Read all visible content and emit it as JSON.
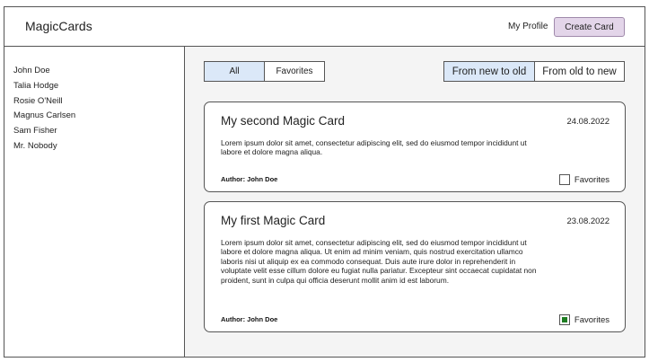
{
  "app": {
    "brand": "MagicCards",
    "nav": {
      "profile_label": "My Profile",
      "create_label": "Create Card"
    }
  },
  "sidebar": {
    "users": [
      "John Doe",
      "Talia Hodge",
      "Rosie O'Neill",
      "Magnus Carlsen",
      "Sam Fisher",
      "Mr. Nobody"
    ]
  },
  "filters": {
    "options": [
      "All",
      "Favorites"
    ],
    "selected": "All",
    "active_color": "#dbe8f8"
  },
  "sort": {
    "options": [
      "From new to old",
      "From old to new"
    ],
    "selected": "From new to old"
  },
  "cards": [
    {
      "title": "My second Magic Card",
      "date": "24.08.2022",
      "body": "Lorem ipsum dolor sit amet, consectetur adipiscing elit, sed do eiusmod tempor incididunt ut labore et dolore magna aliqua.",
      "author": "Author: John Doe",
      "favorite_label": "Favorites",
      "favorite": false
    },
    {
      "title": "My first Magic Card",
      "date": "23.08.2022",
      "body": "Lorem ipsum dolor sit amet, consectetur adipiscing elit, sed do eiusmod tempor incididunt ut labore et dolore magna aliqua. Ut enim ad minim veniam, quis nostrud exercitation ullamco laboris nisi ut aliquip ex ea commodo consequat. Duis aute irure dolor in reprehenderit in voluptate velit esse cillum dolore eu fugiat nulla pariatur. Excepteur sint occaecat cupidatat non proident, sunt in culpa qui officia deserunt mollit anim id est laborum.",
      "author": "Author: John Doe",
      "favorite_label": "Favorites",
      "favorite": true
    }
  ],
  "colors": {
    "create_button_bg": "#e3d5e9",
    "favorite_check": "#1e7d22",
    "main_bg": "#f4f4f4"
  }
}
